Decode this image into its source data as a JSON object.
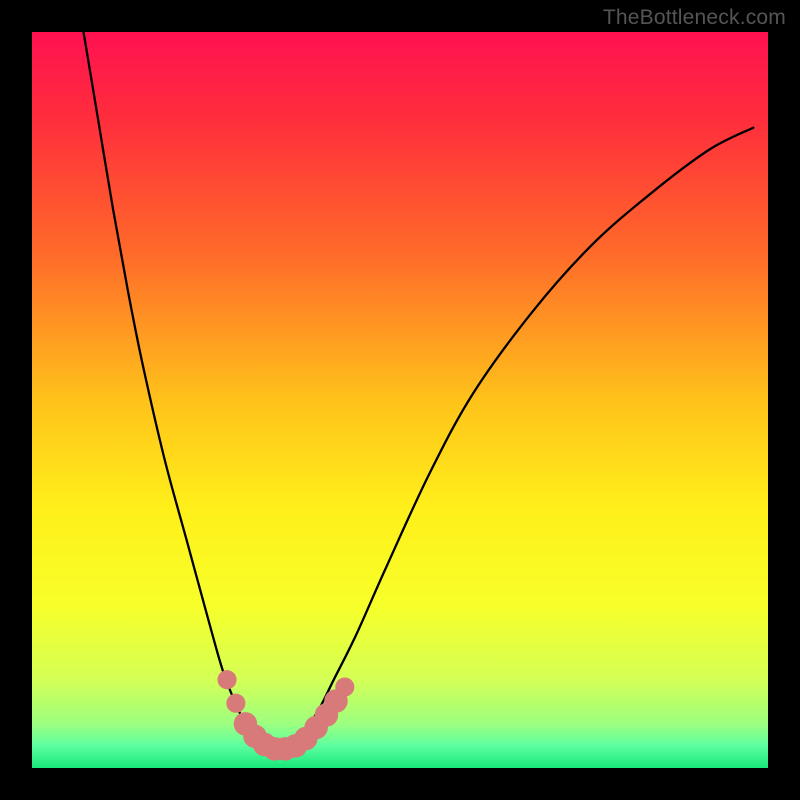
{
  "watermark": "TheBottleneck.com",
  "chart_data": {
    "type": "line",
    "title": "",
    "xlabel": "",
    "ylabel": "",
    "xlim": [
      0,
      100
    ],
    "ylim": [
      0,
      100
    ],
    "grid": false,
    "legend": false,
    "gradient_stops": [
      {
        "offset": 0.0,
        "color": "#ff1151"
      },
      {
        "offset": 0.12,
        "color": "#ff2e3c"
      },
      {
        "offset": 0.3,
        "color": "#ff6a2a"
      },
      {
        "offset": 0.5,
        "color": "#ffc21a"
      },
      {
        "offset": 0.65,
        "color": "#fff01a"
      },
      {
        "offset": 0.78,
        "color": "#f7ff2a"
      },
      {
        "offset": 0.88,
        "color": "#d4ff55"
      },
      {
        "offset": 0.94,
        "color": "#9dff80"
      },
      {
        "offset": 0.97,
        "color": "#5cffa0"
      },
      {
        "offset": 1.0,
        "color": "#17e87a"
      }
    ],
    "series": [
      {
        "name": "bottleneck-curve",
        "x": [
          7,
          9,
          11,
          13,
          15,
          18,
          21,
          24,
          26,
          28,
          30,
          31.5,
          33,
          35,
          37,
          39,
          41,
          44,
          48,
          54,
          60,
          68,
          76,
          84,
          92,
          98
        ],
        "y": [
          100,
          88,
          76,
          65,
          55,
          42,
          31,
          20,
          13,
          8,
          4,
          2.5,
          2.5,
          3,
          5,
          8,
          12,
          18,
          27,
          40,
          51,
          62,
          71,
          78,
          84,
          87
        ]
      }
    ],
    "markers": [
      {
        "name": "data-point",
        "x": 26.5,
        "y": 12,
        "r": 1.3
      },
      {
        "name": "data-point",
        "x": 27.7,
        "y": 8.8,
        "r": 1.3
      },
      {
        "name": "data-point",
        "x": 29.0,
        "y": 6.0,
        "r": 1.6
      },
      {
        "name": "data-point",
        "x": 30.3,
        "y": 4.3,
        "r": 1.6
      },
      {
        "name": "data-point",
        "x": 31.6,
        "y": 3.2,
        "r": 1.6
      },
      {
        "name": "data-point",
        "x": 33.0,
        "y": 2.6,
        "r": 1.6
      },
      {
        "name": "data-point",
        "x": 34.4,
        "y": 2.6,
        "r": 1.6
      },
      {
        "name": "data-point",
        "x": 35.8,
        "y": 3.0,
        "r": 1.6
      },
      {
        "name": "data-point",
        "x": 37.2,
        "y": 4.0,
        "r": 1.6
      },
      {
        "name": "data-point",
        "x": 38.6,
        "y": 5.5,
        "r": 1.6
      },
      {
        "name": "data-point",
        "x": 40.0,
        "y": 7.2,
        "r": 1.6
      },
      {
        "name": "data-point",
        "x": 41.3,
        "y": 9.1,
        "r": 1.6
      },
      {
        "name": "data-point",
        "x": 42.5,
        "y": 11.0,
        "r": 1.3
      }
    ]
  }
}
